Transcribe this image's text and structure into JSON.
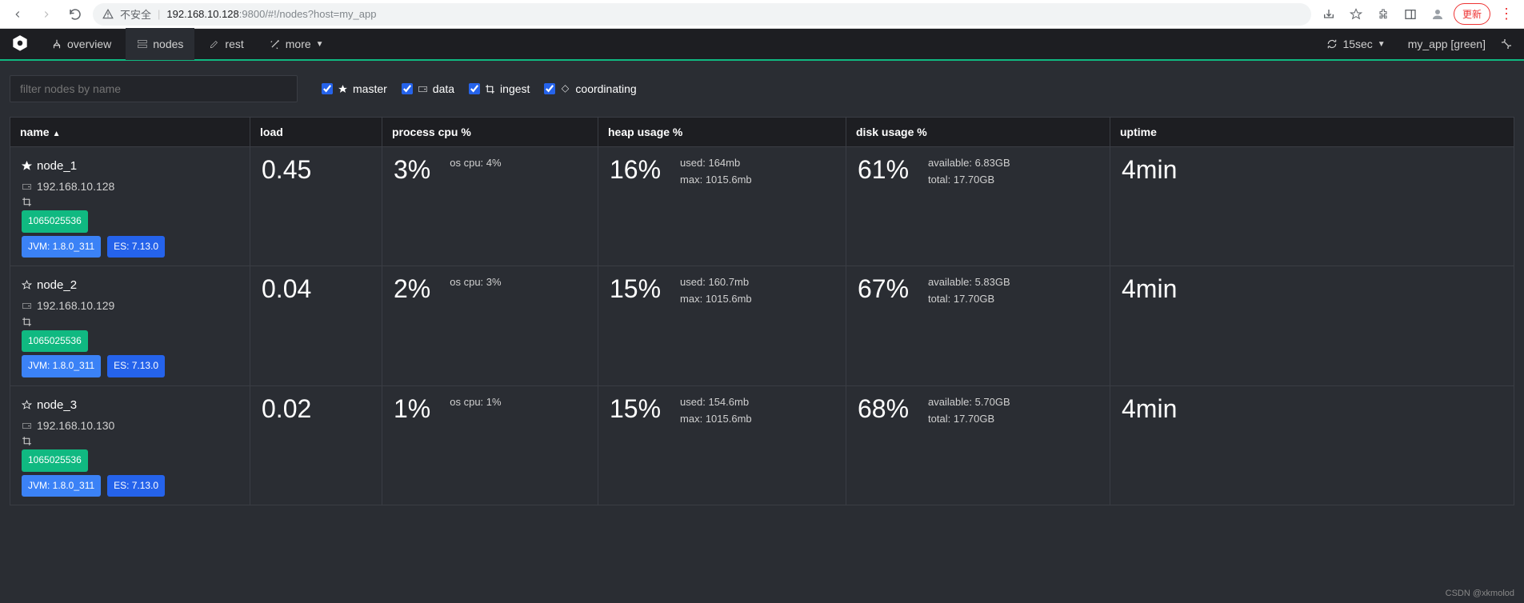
{
  "browser": {
    "insecure_label": "不安全",
    "url_host": "192.168.10.128",
    "url_port_path": ":9800/#!/nodes?host=my_app",
    "update_label": "更新"
  },
  "nav": {
    "overview": "overview",
    "nodes": "nodes",
    "rest": "rest",
    "more": "more",
    "refresh_interval": "15sec",
    "cluster_status": "my_app [green]"
  },
  "filter": {
    "placeholder": "filter nodes by name",
    "master": "master",
    "data": "data",
    "ingest": "ingest",
    "coordinating": "coordinating"
  },
  "columns": {
    "name": "name",
    "load": "load",
    "cpu": "process cpu %",
    "heap": "heap usage %",
    "disk": "disk usage %",
    "uptime": "uptime"
  },
  "nodes": [
    {
      "name": "node_1",
      "ip": "192.168.10.128",
      "master": true,
      "id": "1065025536",
      "jvm": "JVM: 1.8.0_311",
      "es": "ES: 7.13.0",
      "load": "0.45",
      "cpu": "3%",
      "os_cpu": "os cpu: 4%",
      "heap": "16%",
      "heap_used": "used: 164mb",
      "heap_max": "max: 1015.6mb",
      "disk": "61%",
      "disk_avail": "available: 6.83GB",
      "disk_total": "total: 17.70GB",
      "uptime": "4min"
    },
    {
      "name": "node_2",
      "ip": "192.168.10.129",
      "master": false,
      "id": "1065025536",
      "jvm": "JVM: 1.8.0_311",
      "es": "ES: 7.13.0",
      "load": "0.04",
      "cpu": "2%",
      "os_cpu": "os cpu: 3%",
      "heap": "15%",
      "heap_used": "used: 160.7mb",
      "heap_max": "max: 1015.6mb",
      "disk": "67%",
      "disk_avail": "available: 5.83GB",
      "disk_total": "total: 17.70GB",
      "uptime": "4min"
    },
    {
      "name": "node_3",
      "ip": "192.168.10.130",
      "master": false,
      "id": "1065025536",
      "jvm": "JVM: 1.8.0_311",
      "es": "ES: 7.13.0",
      "load": "0.02",
      "cpu": "1%",
      "os_cpu": "os cpu: 1%",
      "heap": "15%",
      "heap_used": "used: 154.6mb",
      "heap_max": "max: 1015.6mb",
      "disk": "68%",
      "disk_avail": "available: 5.70GB",
      "disk_total": "total: 17.70GB",
      "uptime": "4min"
    }
  ],
  "footer": "CSDN @xkmolod"
}
